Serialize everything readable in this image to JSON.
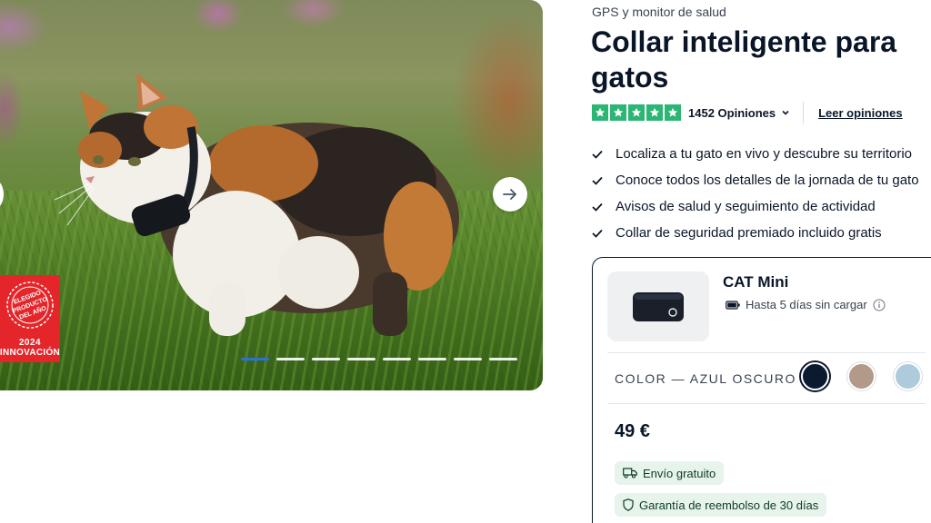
{
  "gallery": {
    "award": {
      "seal_text": "ELEGIDO PRODUCTO DEL AÑO",
      "year": "2024",
      "label": "INNOVACIÓN"
    },
    "next_icon": "arrow-right-icon",
    "dot_count": 8,
    "active_dot": 1
  },
  "product": {
    "eyebrow": "GPS y monitor de salud",
    "title": "Collar inteligente para gatos",
    "rating": {
      "stars": 5,
      "reviews_label": "1452 Opiniones",
      "read_reviews": "Leer opiniones",
      "star_color": "#2bb673"
    },
    "features": [
      "Localiza a tu gato en vivo y descubre su territorio",
      "Conoce todos los detalles de la jornada de tu gato",
      "Avisos de salud y seguimiento de actividad",
      "Collar de seguridad premiado incluido gratis"
    ]
  },
  "variant_card": {
    "name": "CAT Mini",
    "battery": "Hasta 5 días sin cargar",
    "color_label": "COLOR — AZUL OSCURO",
    "colors": [
      {
        "name": "Azul oscuro",
        "hex": "#0b1a2e",
        "selected": true
      },
      {
        "name": "Beige",
        "hex": "#b3998a",
        "selected": false
      },
      {
        "name": "Azul claro",
        "hex": "#aecbdc",
        "selected": false
      }
    ],
    "price": "49 €",
    "shipping": "Envío gratuito",
    "guarantee": "Garantía de reembolso de 30 días"
  }
}
